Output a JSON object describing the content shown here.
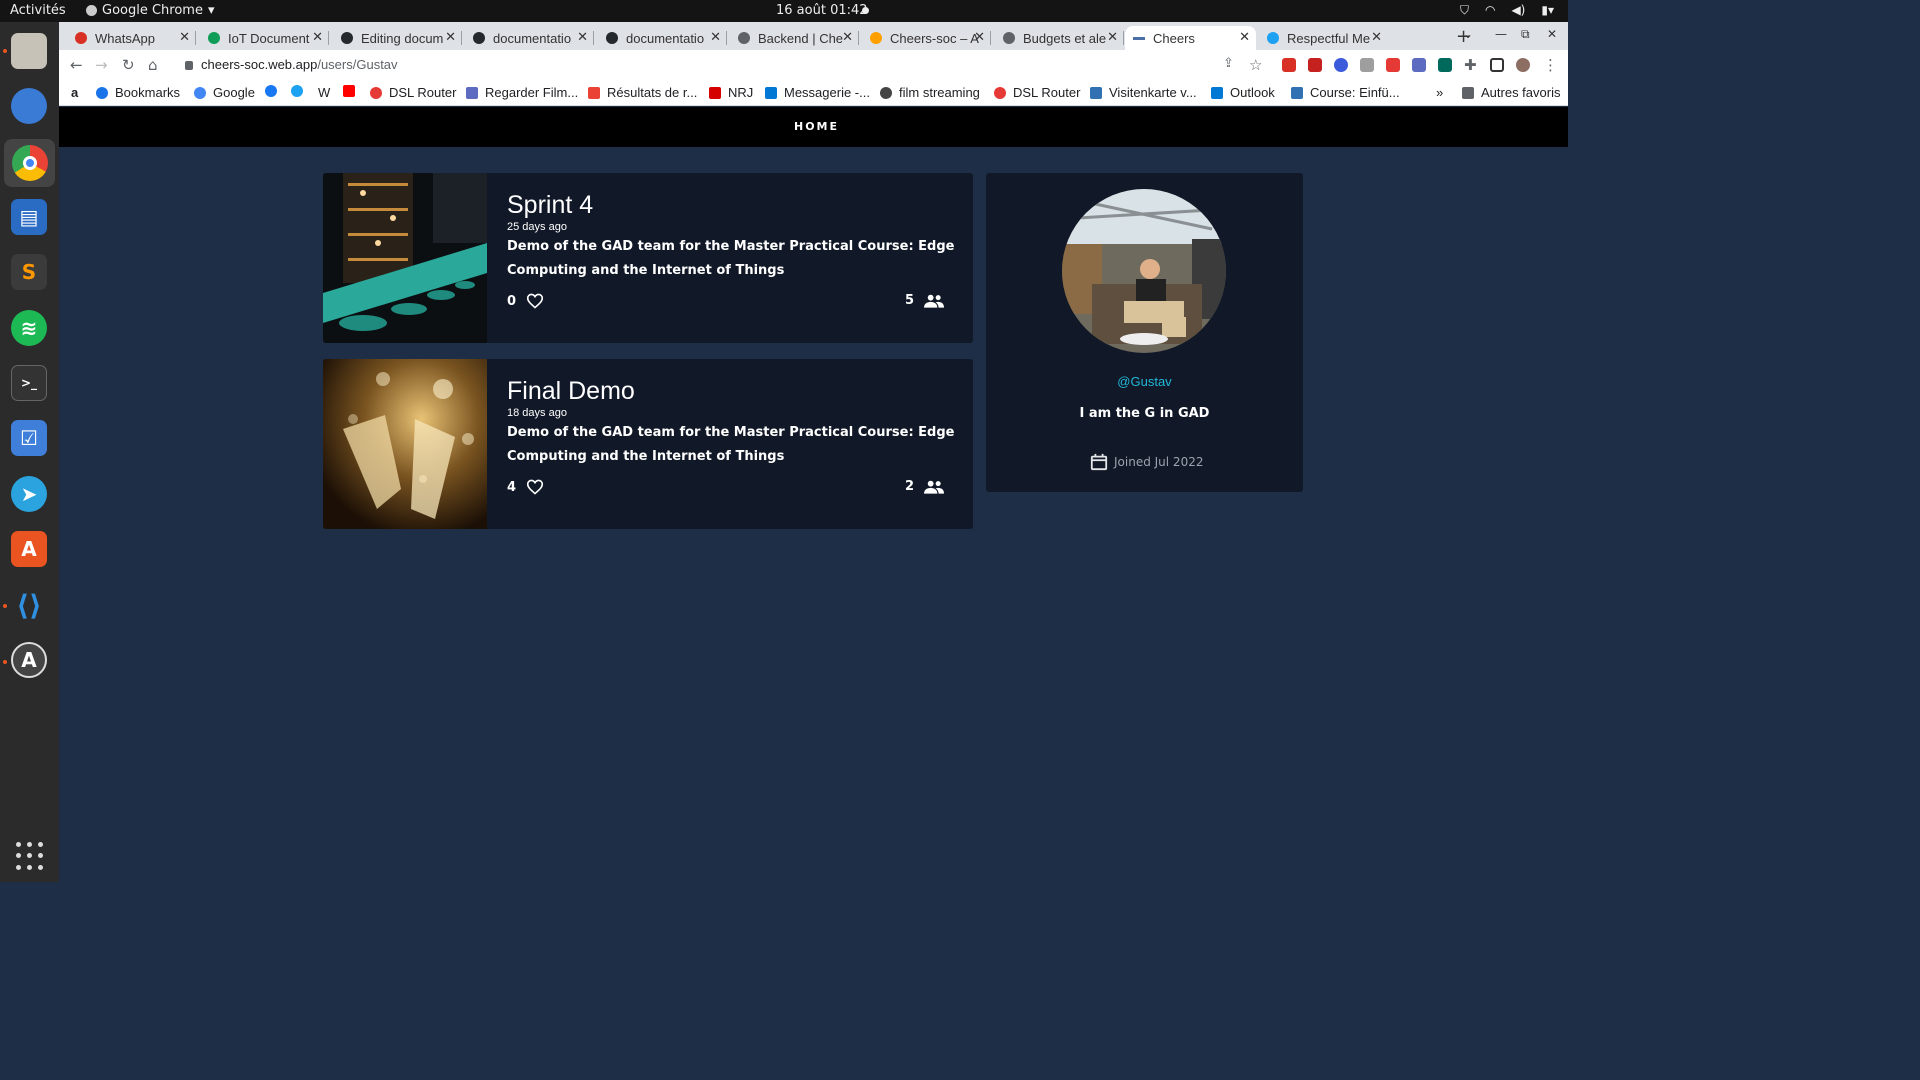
{
  "os": {
    "activities": "Activités",
    "app_name": "Google Chrome",
    "clock": "16 août  01:42"
  },
  "browser": {
    "tabs": [
      {
        "label": "WhatsApp"
      },
      {
        "label": "IoT Document"
      },
      {
        "label": "Editing docum"
      },
      {
        "label": "documentatio"
      },
      {
        "label": "documentatio"
      },
      {
        "label": "Backend | Che"
      },
      {
        "label": "Cheers-soc – A"
      },
      {
        "label": "Budgets et ale"
      },
      {
        "label": "Cheers"
      },
      {
        "label": "Respectful Me"
      }
    ],
    "url_host": "cheers-soc.web.app",
    "url_path": "/users/Gustav",
    "bookmarks": [
      "Bookmarks",
      "Google",
      "W",
      "DSL Router",
      "Regarder Film...",
      "Résultats de r...",
      "NRJ",
      "Messagerie -...",
      "film streaming",
      "DSL Router",
      "Visitenkarte v...",
      "Outlook",
      "Course: Einfü..."
    ],
    "other_bookmarks": "Autres favoris"
  },
  "site": {
    "nav_home": "HOME"
  },
  "events": [
    {
      "title": "Sprint 4",
      "ago": "25 days ago",
      "description": "Demo of the GAD team for the Master Practical Course: Edge Computing and the Internet of Things",
      "likes": "0",
      "attendees": "5"
    },
    {
      "title": "Final Demo",
      "ago": "18 days ago",
      "description": "Demo of the GAD team for the Master Practical Course: Edge Computing and the Internet of Things",
      "likes": "4",
      "attendees": "2"
    }
  ],
  "profile": {
    "handle": "@Gustav",
    "bio": "I am the G in GAD",
    "joined": "Joined Jul 2022"
  },
  "colors": {
    "page_bg": "#1f2e47",
    "card_bg": "#111827",
    "handle": "#22b8d8"
  }
}
